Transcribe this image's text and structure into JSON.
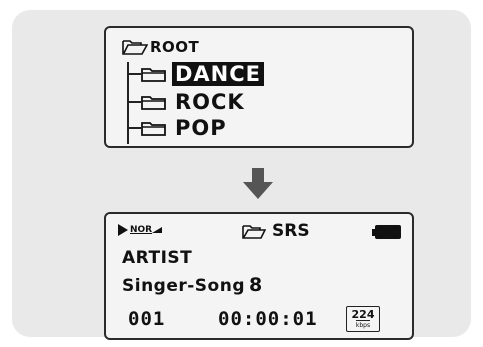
{
  "browser": {
    "root_label": "ROOT",
    "folders": [
      {
        "label": "DANCE",
        "selected": true
      },
      {
        "label": "ROCK",
        "selected": false
      },
      {
        "label": "POP",
        "selected": false
      }
    ]
  },
  "player": {
    "play_icon": "play-triangle",
    "eq_mode": "NOR",
    "folder_label": "SRS",
    "battery_icon": "battery-full",
    "artist": "ARTIST",
    "title": "Singer-Song",
    "title_number": "8",
    "track_number": "001",
    "elapsed_time": "00:00:01",
    "bitrate_value": "224",
    "bitrate_unit": "kbps"
  },
  "arrow_icon": "down-arrow"
}
